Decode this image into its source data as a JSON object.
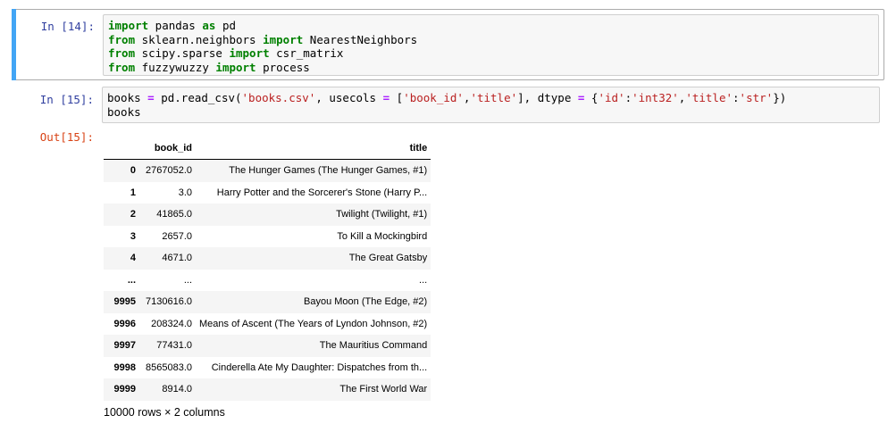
{
  "cells": {
    "cell14": {
      "prompt": "In [14]:",
      "lines": [
        [
          {
            "t": "import",
            "c": "kw"
          },
          {
            "t": " pandas ",
            "c": "pn"
          },
          {
            "t": "as",
            "c": "kw"
          },
          {
            "t": " pd",
            "c": "pn"
          }
        ],
        [
          {
            "t": "from",
            "c": "kw"
          },
          {
            "t": " sklearn.neighbors ",
            "c": "pn"
          },
          {
            "t": "import",
            "c": "kw"
          },
          {
            "t": " NearestNeighbors",
            "c": "pn"
          }
        ],
        [
          {
            "t": "from",
            "c": "kw"
          },
          {
            "t": " scipy.sparse ",
            "c": "pn"
          },
          {
            "t": "import",
            "c": "kw"
          },
          {
            "t": " csr_matrix",
            "c": "pn"
          }
        ],
        [
          {
            "t": "from",
            "c": "kw"
          },
          {
            "t": " fuzzywuzzy ",
            "c": "pn"
          },
          {
            "t": "import",
            "c": "kw"
          },
          {
            "t": " process",
            "c": "pn"
          }
        ]
      ]
    },
    "cell15": {
      "prompt": "In [15]:",
      "out_prompt": "Out[15]:",
      "lines": [
        [
          {
            "t": "books ",
            "c": "pn"
          },
          {
            "t": "=",
            "c": "op"
          },
          {
            "t": " pd.read_csv(",
            "c": "pn"
          },
          {
            "t": "'books.csv'",
            "c": "str"
          },
          {
            "t": ", usecols ",
            "c": "pn"
          },
          {
            "t": "=",
            "c": "op"
          },
          {
            "t": " [",
            "c": "pn"
          },
          {
            "t": "'book_id'",
            "c": "str"
          },
          {
            "t": ",",
            "c": "pn"
          },
          {
            "t": "'title'",
            "c": "str"
          },
          {
            "t": "], dtype ",
            "c": "pn"
          },
          {
            "t": "=",
            "c": "op"
          },
          {
            "t": " {",
            "c": "pn"
          },
          {
            "t": "'id'",
            "c": "str"
          },
          {
            "t": ":",
            "c": "pn"
          },
          {
            "t": "'int32'",
            "c": "str"
          },
          {
            "t": ",",
            "c": "pn"
          },
          {
            "t": "'title'",
            "c": "str"
          },
          {
            "t": ":",
            "c": "pn"
          },
          {
            "t": "'str'",
            "c": "str"
          },
          {
            "t": "})",
            "c": "pn"
          }
        ],
        [
          {
            "t": "books",
            "c": "pn"
          }
        ]
      ]
    }
  },
  "table": {
    "columns": [
      "",
      "book_id",
      "title"
    ],
    "rows": [
      [
        "0",
        "2767052.0",
        "The Hunger Games (The Hunger Games, #1)"
      ],
      [
        "1",
        "3.0",
        "Harry Potter and the Sorcerer's Stone (Harry P..."
      ],
      [
        "2",
        "41865.0",
        "Twilight (Twilight, #1)"
      ],
      [
        "3",
        "2657.0",
        "To Kill a Mockingbird"
      ],
      [
        "4",
        "4671.0",
        "The Great Gatsby"
      ],
      [
        "...",
        "...",
        "..."
      ],
      [
        "9995",
        "7130616.0",
        "Bayou Moon (The Edge, #2)"
      ],
      [
        "9996",
        "208324.0",
        "Means of Ascent (The Years of Lyndon Johnson, #2)"
      ],
      [
        "9997",
        "77431.0",
        "The Mauritius Command"
      ],
      [
        "9998",
        "8565083.0",
        "Cinderella Ate My Daughter: Dispatches from th..."
      ],
      [
        "9999",
        "8914.0",
        "The First World War"
      ]
    ],
    "summary": "10000 rows × 2 columns"
  },
  "colors": {
    "selected_bar": "#42a5f5",
    "prompt_in": "#303f9f",
    "prompt_out": "#d84315",
    "keyword": "#008000",
    "string": "#ba2121"
  }
}
